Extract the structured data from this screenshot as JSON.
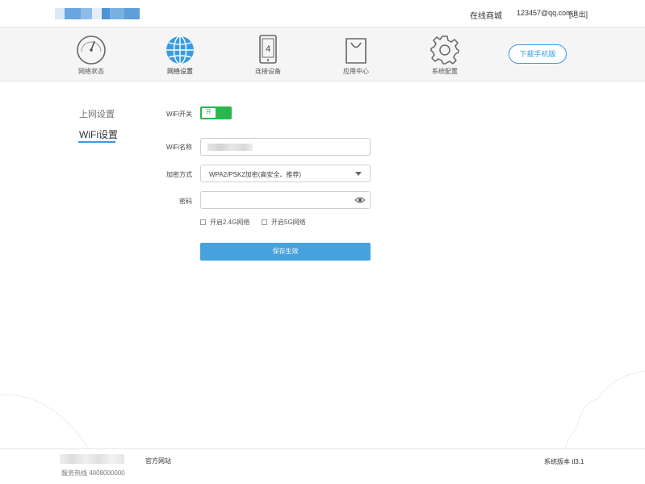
{
  "header": {
    "store_link": "在线商城",
    "user_email": "123457@qq.com",
    "logout": "[退出]"
  },
  "nav": {
    "items": [
      {
        "label": "网络状态",
        "icon": "speedometer-icon"
      },
      {
        "label": "网络设置",
        "icon": "globe-icon",
        "active": true
      },
      {
        "label": "连接设备",
        "icon": "tablet-icon",
        "badge": "4"
      },
      {
        "label": "应用中心",
        "icon": "shopping-bag-icon"
      },
      {
        "label": "系统配置",
        "icon": "gear-icon"
      }
    ],
    "download_button": "下载手机版"
  },
  "sidebar": {
    "items": [
      {
        "label": "上网设置"
      },
      {
        "label": "WiFi设置",
        "active": true
      }
    ]
  },
  "form": {
    "wifi_switch_label": "WiFi开关",
    "wifi_switch_state": "开",
    "wifi_name_label": "WiFi名称",
    "encryption_label": "加密方式",
    "encryption_value": "WPA2/PSK2加密(高安全、推荐)",
    "password_label": "密码",
    "password_value": "",
    "enable_24g_label": "开启2.4G网络",
    "enable_5g_label": "开启5G网络",
    "save_button": "保存生效"
  },
  "footer": {
    "official_site": "官方网站",
    "hotline": "服务热线  4008000000",
    "version": "系统版本 tl3.1"
  },
  "colors": {
    "accent": "#3a9be0",
    "toggle_on": "#2ab84e",
    "save_button": "#46a1df"
  }
}
